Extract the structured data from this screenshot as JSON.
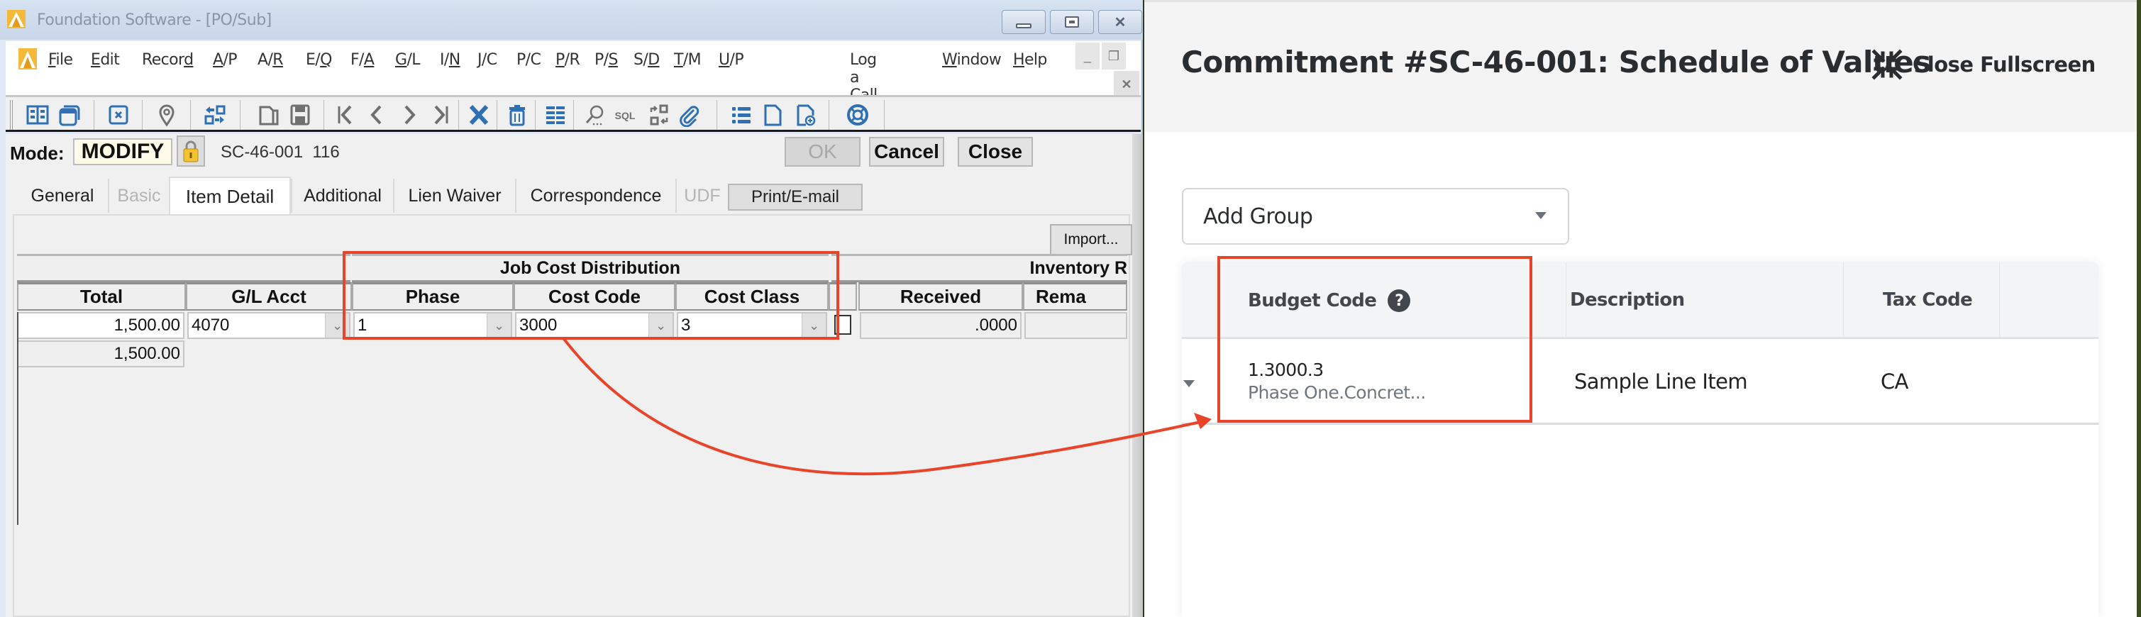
{
  "left_app": {
    "window_title": "Foundation Software - [PO/Sub]",
    "window_controls": {
      "minimize": "minimize",
      "maximize": "maximize",
      "close": "close"
    },
    "menu": [
      {
        "label": "File",
        "u": 0
      },
      {
        "label": "Edit",
        "u": 0
      },
      {
        "label": "Record",
        "u": 5
      },
      {
        "label": "A/P",
        "u": 0
      },
      {
        "label": "A/R",
        "u": 2
      },
      {
        "label": "E/Q",
        "u": 2
      },
      {
        "label": "F/A",
        "u": 2
      },
      {
        "label": "G/L",
        "u": 0
      },
      {
        "label": "I/N",
        "u": 2
      },
      {
        "label": "J/C",
        "u": 0
      },
      {
        "label": "P/C",
        "u": -1
      },
      {
        "label": "P/R",
        "u": 0
      },
      {
        "label": "P/S",
        "u": 2
      },
      {
        "label": "S/D",
        "u": 2
      },
      {
        "label": "T/M",
        "u": 0
      },
      {
        "label": "U/P",
        "u": 0
      },
      {
        "label": "Log a Call",
        "u": 6
      },
      {
        "label": "Window",
        "u": 0
      },
      {
        "label": "Help",
        "u": 0
      }
    ],
    "mdi_controls": {
      "minimize": "_",
      "restore": "restore",
      "close": "x"
    },
    "toolbar_icons": [
      "book-icon",
      "windows-icon",
      "close-record-icon",
      "location-pin-icon",
      "transfer-icon",
      "new-folder-icon",
      "save-icon",
      "first-record-icon",
      "previous-record-icon",
      "next-record-icon",
      "last-record-icon",
      "delete-x-icon",
      "trash-icon",
      "grid-view-icon",
      "search-icon",
      "sql-icon",
      "swap-icon",
      "attachment-icon",
      "list-icon",
      "document-icon",
      "add-document-icon",
      "help-lifebuoy-icon"
    ],
    "mode_label": "Mode:",
    "mode_value": "MODIFY",
    "record_id": "SC-46-001",
    "record_number": "116",
    "buttons": {
      "ok": "OK",
      "cancel": "Cancel",
      "close": "Close"
    },
    "tabs": [
      {
        "label": "General",
        "state": "normal"
      },
      {
        "label": "Basic",
        "state": "disabled"
      },
      {
        "label": "Item Detail",
        "state": "active"
      },
      {
        "label": "Additional",
        "state": "normal"
      },
      {
        "label": "Lien Waiver",
        "state": "normal"
      },
      {
        "label": "Correspondence",
        "state": "normal"
      },
      {
        "label": "UDF",
        "state": "disabled"
      },
      {
        "label": "Print/E-mail",
        "state": "button"
      }
    ],
    "import_label": "Import...",
    "grid": {
      "group_headers": {
        "job_cost": "Job Cost Distribution",
        "inventory": "Inventory R"
      },
      "columns": [
        "Total",
        "G/L Acct",
        "Phase",
        "Cost Code",
        "Cost Class",
        "Received",
        "Rema"
      ],
      "row": {
        "total": "1,500.00",
        "gl_acct": "4070",
        "phase": "1",
        "cost_code": "3000",
        "cost_class": "3",
        "received": ".0000",
        "checked": false
      },
      "total_footer": "1,500.00"
    }
  },
  "right_app": {
    "page_title": "Commitment #SC-46-001: Schedule of Values",
    "close_fullscreen_label": "Close Fullscreen",
    "add_group_label": "Add Group",
    "table": {
      "columns": [
        "Budget Code",
        "Description",
        "Tax Code"
      ],
      "rows": [
        {
          "budget_code": "1.3000.3",
          "budget_code_desc": "Phase One.Concret...",
          "description": "Sample Line Item",
          "tax_code": "CA"
        }
      ]
    }
  },
  "annotation": {
    "color": "#e8442a",
    "meaning": "Phase / Cost Code / Cost Class maps to Budget Code"
  }
}
